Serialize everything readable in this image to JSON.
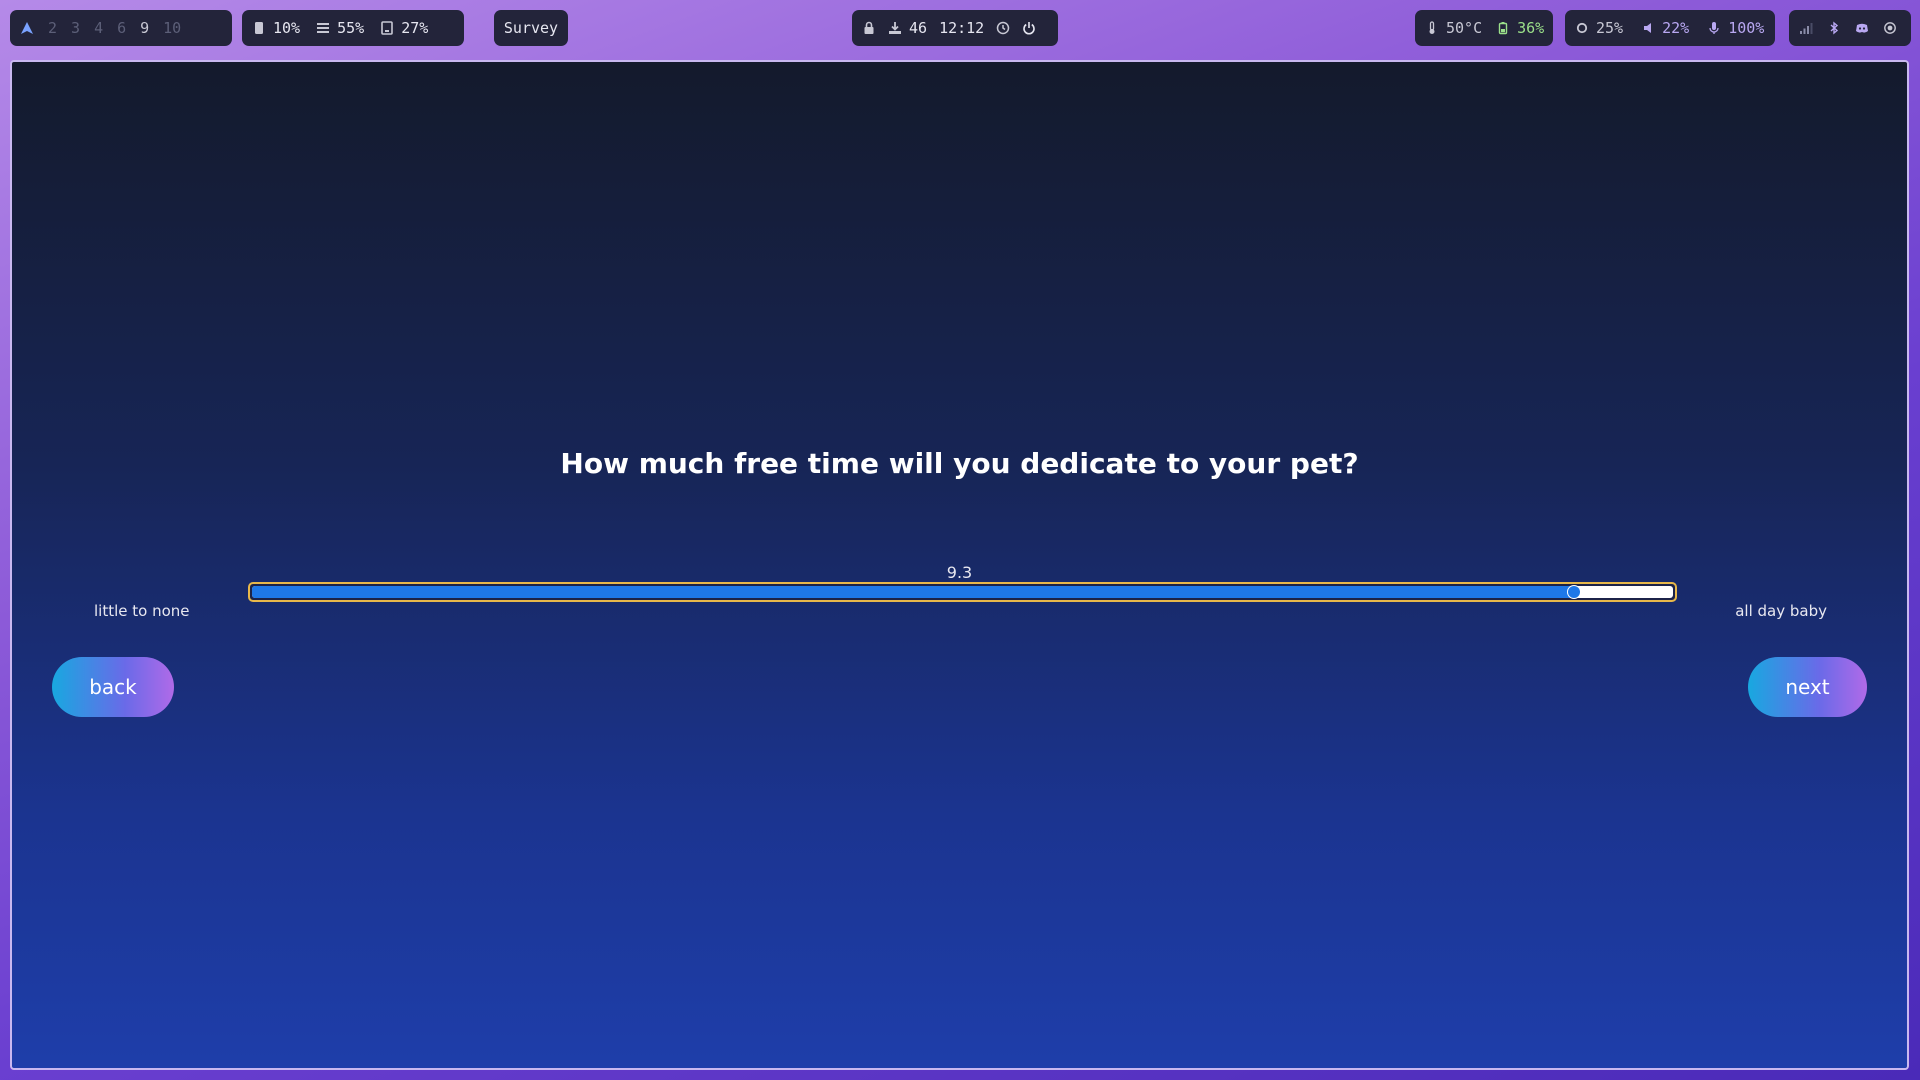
{
  "topbar": {
    "workspaces": [
      "2",
      "3",
      "4",
      "6",
      "9",
      "10"
    ],
    "stats": {
      "disk": "10%",
      "memory": "55%",
      "swap": "27%"
    },
    "window_title": "Survey",
    "center": {
      "updates": "46",
      "clock": "12:12"
    },
    "sensors": {
      "temperature": "50°C",
      "battery": "36%"
    },
    "levels": {
      "brightness": "25%",
      "volume": "22%",
      "microphone": "100%"
    }
  },
  "survey": {
    "question": "How much free time will you dedicate to your pet?",
    "slider": {
      "value": "9.3",
      "min_label": "little to none",
      "max_label": "all day baby",
      "fill_fraction": 0.93
    },
    "back_label": "back",
    "next_label": "next"
  },
  "colors": {
    "accent": "#1e78e8",
    "slider_border": "#e8b84a",
    "button_start": "#18a8e0",
    "button_end": "#b06ae8"
  }
}
